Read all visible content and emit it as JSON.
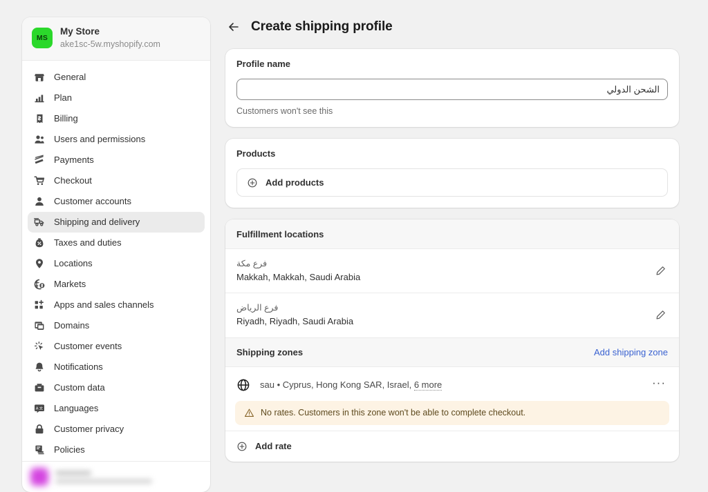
{
  "sidebar": {
    "store": {
      "initials": "MS",
      "name": "My Store",
      "domain": "ake1sc-5w.myshopify.com",
      "avatar_color": "#2bd82b"
    },
    "items": [
      {
        "label": "General",
        "icon": "store-icon"
      },
      {
        "label": "Plan",
        "icon": "chart-icon"
      },
      {
        "label": "Billing",
        "icon": "receipt-icon"
      },
      {
        "label": "Users and permissions",
        "icon": "users-icon"
      },
      {
        "label": "Payments",
        "icon": "payments-icon"
      },
      {
        "label": "Checkout",
        "icon": "cart-icon"
      },
      {
        "label": "Customer accounts",
        "icon": "person-icon"
      },
      {
        "label": "Shipping and delivery",
        "icon": "delivery-truck-icon"
      },
      {
        "label": "Taxes and duties",
        "icon": "taxes-icon"
      },
      {
        "label": "Locations",
        "icon": "location-pin-icon"
      },
      {
        "label": "Markets",
        "icon": "globe-money-icon"
      },
      {
        "label": "Apps and sales channels",
        "icon": "apps-grid-icon"
      },
      {
        "label": "Domains",
        "icon": "domains-icon"
      },
      {
        "label": "Customer events",
        "icon": "cursor-click-icon"
      },
      {
        "label": "Notifications",
        "icon": "bell-icon"
      },
      {
        "label": "Custom data",
        "icon": "database-icon"
      },
      {
        "label": "Languages",
        "icon": "translate-icon"
      },
      {
        "label": "Customer privacy",
        "icon": "lock-icon"
      },
      {
        "label": "Policies",
        "icon": "policies-icon"
      }
    ],
    "active_item": "Shipping and delivery"
  },
  "header": {
    "back_icon": "arrow-left-icon",
    "title": "Create shipping profile"
  },
  "profile_name_card": {
    "heading": "Profile name",
    "input_value": "الشحن الدولي",
    "help_text": "Customers won't see this"
  },
  "products_card": {
    "heading": "Products",
    "add_products_label": "Add products",
    "add_icon": "plus-circle-icon"
  },
  "fulfillment_card": {
    "heading": "Fulfillment locations",
    "locations": [
      {
        "name_ar": "فرع مكة",
        "address": "Makkah, Makkah, Saudi Arabia",
        "edit_icon": "pencil-icon"
      },
      {
        "name_ar": "فرع الرياض",
        "address": "Riyadh, Riyadh, Saudi Arabia",
        "edit_icon": "pencil-icon"
      }
    ],
    "shipping_zones": {
      "title": "Shipping zones",
      "add_zone_label": "Add shipping zone",
      "add_zone_color": "#3a62d1",
      "zone": {
        "icon": "globe-icon",
        "name": "sau",
        "separator": "•",
        "countries": "Cyprus, Hong Kong SAR, Israel,",
        "more_label": "6 more",
        "menu_icon": "ellipsis-icon"
      },
      "banner": {
        "icon": "warning-triangle-icon",
        "text": "No rates. Customers in this zone won't be able to complete checkout.",
        "background": "#fdf3e4",
        "text_color": "#5e4a1e"
      },
      "add_rate_label": "Add rate",
      "add_rate_icon": "plus-circle-icon"
    }
  }
}
